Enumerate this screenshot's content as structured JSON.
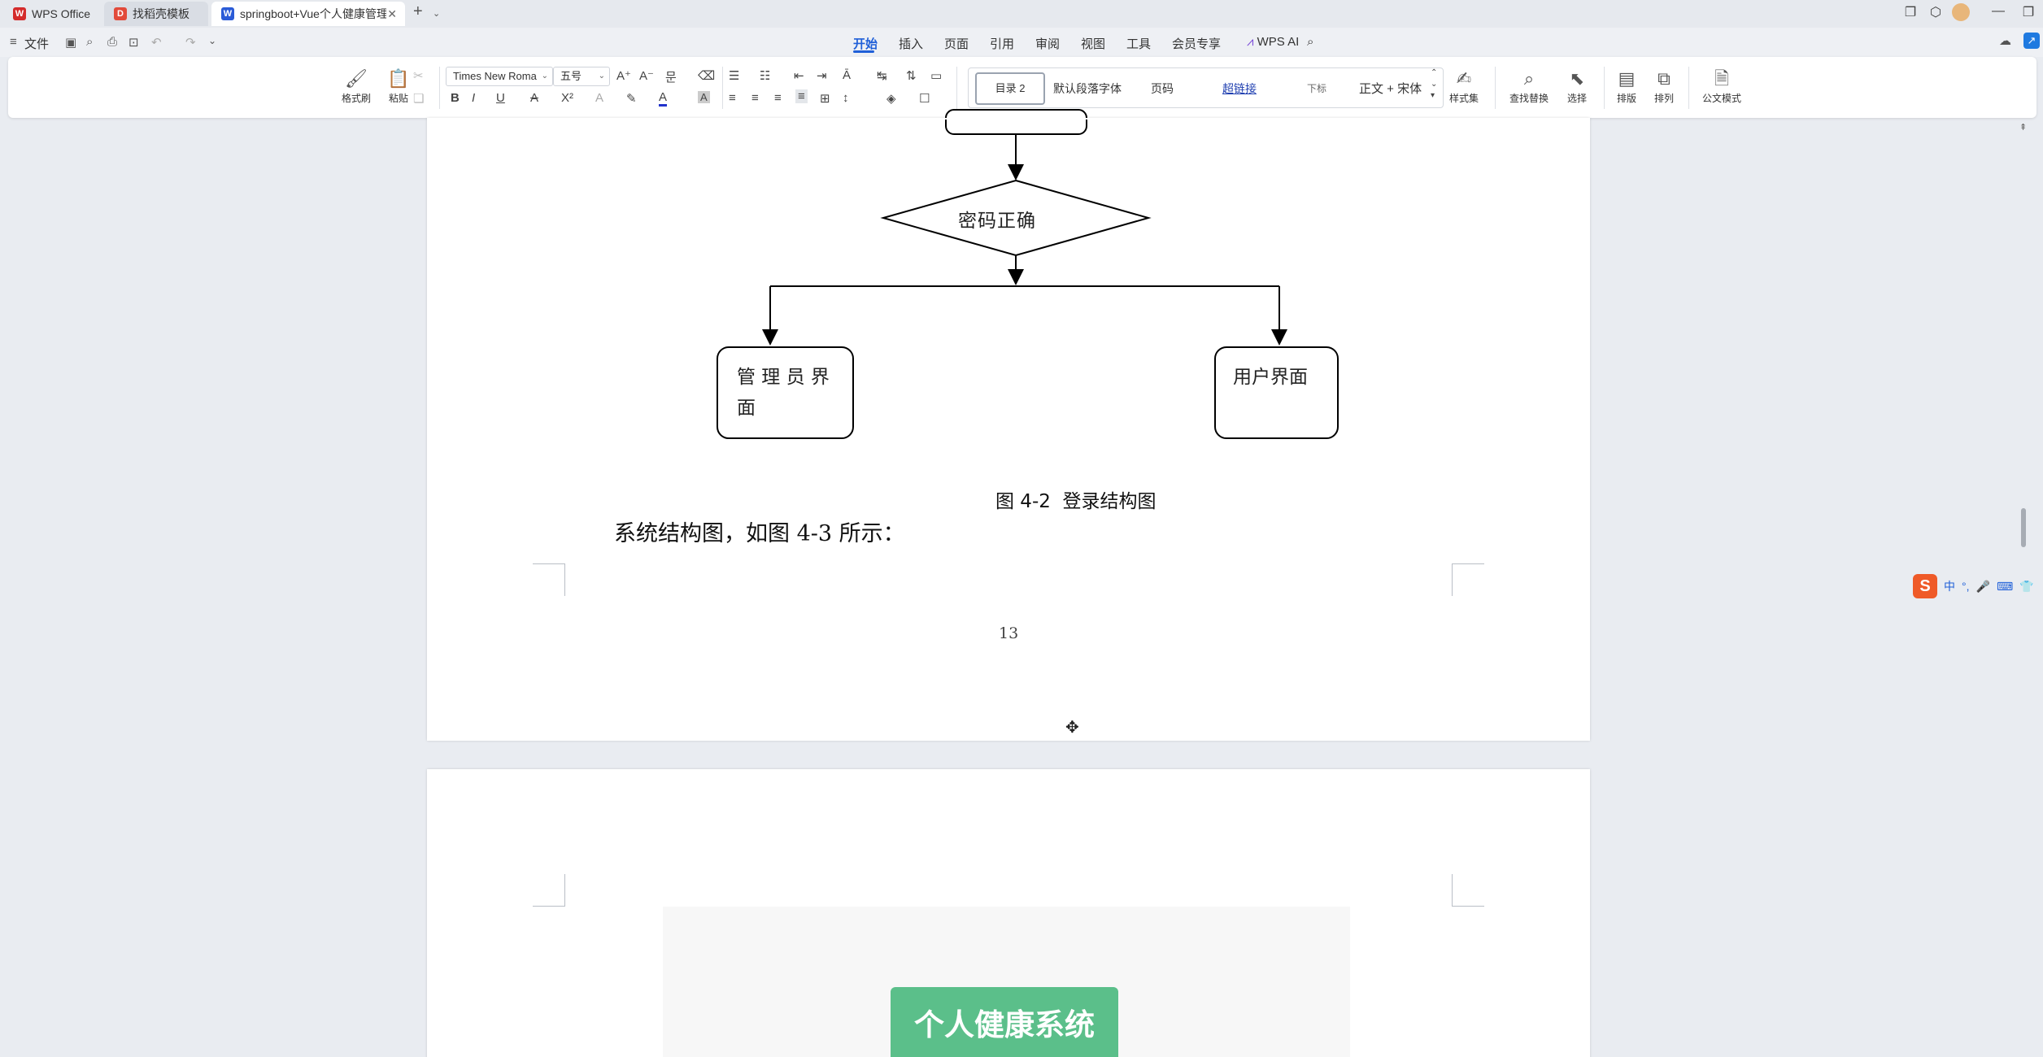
{
  "tabs": [
    {
      "label": "WPS Office",
      "icon": "wps-logo-icon",
      "color": "#d42b2b"
    },
    {
      "label": "找稻壳模板",
      "icon": "docer-logo-icon",
      "color": "#e24a3a"
    },
    {
      "label": "springboot+Vue个人健康管理系",
      "icon": "word-doc-icon",
      "color": "#2a5bd7"
    }
  ],
  "menubar": {
    "file": "文件",
    "items": [
      "开始",
      "插入",
      "页面",
      "引用",
      "审阅",
      "视图",
      "工具",
      "会员专享"
    ],
    "active": "开始",
    "ai": "WPS AI"
  },
  "ribbon": {
    "format_painter": "格式刷",
    "paste": "粘贴",
    "font_name": "Times New Roma",
    "font_size": "五号",
    "styles": [
      "目录 2",
      "默认段落字体",
      "页码",
      "超链接",
      "下标",
      "正文 + 宋体"
    ],
    "style_set": "样式集",
    "find_replace": "查找替换",
    "select": "选择",
    "layout": "排版",
    "arrange": "排列",
    "official_doc": "公文模式"
  },
  "document": {
    "flowchart": {
      "decision": "密码正确",
      "admin_box": [
        "管 理 员 界",
        "面"
      ],
      "user_box": "用户界面"
    },
    "caption": "图 4-2  登录结构图",
    "paragraph": "系统结构图，如图 4-3 所示：",
    "page_number": "13",
    "next_figure_title": "个人健康系统"
  },
  "ime": {
    "labels": [
      "中",
      "°,",
      "🎤",
      "⌨",
      "👕"
    ]
  },
  "colors": {
    "accent": "#1f5fd8",
    "health_green": "#5bbf8a"
  }
}
